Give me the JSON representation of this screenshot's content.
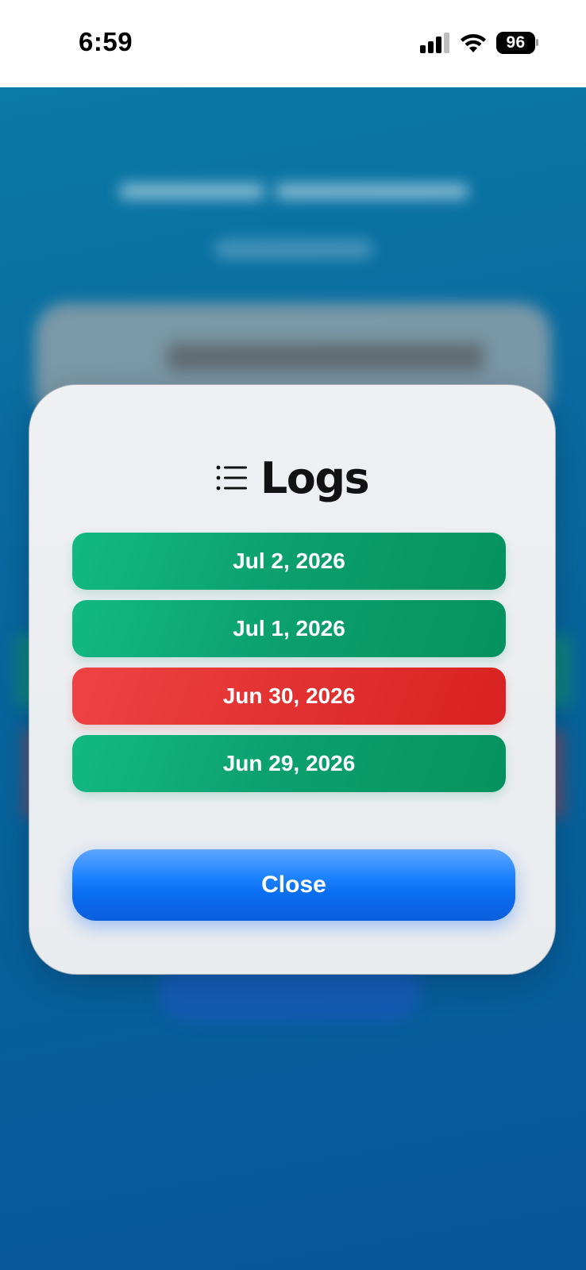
{
  "status_bar": {
    "time": "6:59",
    "battery": "96",
    "signal_icon": "cellular-signal-icon",
    "wifi_icon": "wifi-icon"
  },
  "modal": {
    "icon": "list-icon",
    "title": "Logs",
    "logs": [
      {
        "date": "Jul 2, 2026",
        "status": "success",
        "color": "#10b27a"
      },
      {
        "date": "Jul 1, 2026",
        "status": "success",
        "color": "#10b27a"
      },
      {
        "date": "Jun 30, 2026",
        "status": "failure",
        "color": "#e53535"
      },
      {
        "date": "Jun 29, 2026",
        "status": "success",
        "color": "#10b27a"
      }
    ],
    "close_label": "Close",
    "close_color": "#0a6ff2"
  },
  "background": {
    "gradient_top": "#0a7aa6",
    "gradient_bottom": "#08569a"
  }
}
